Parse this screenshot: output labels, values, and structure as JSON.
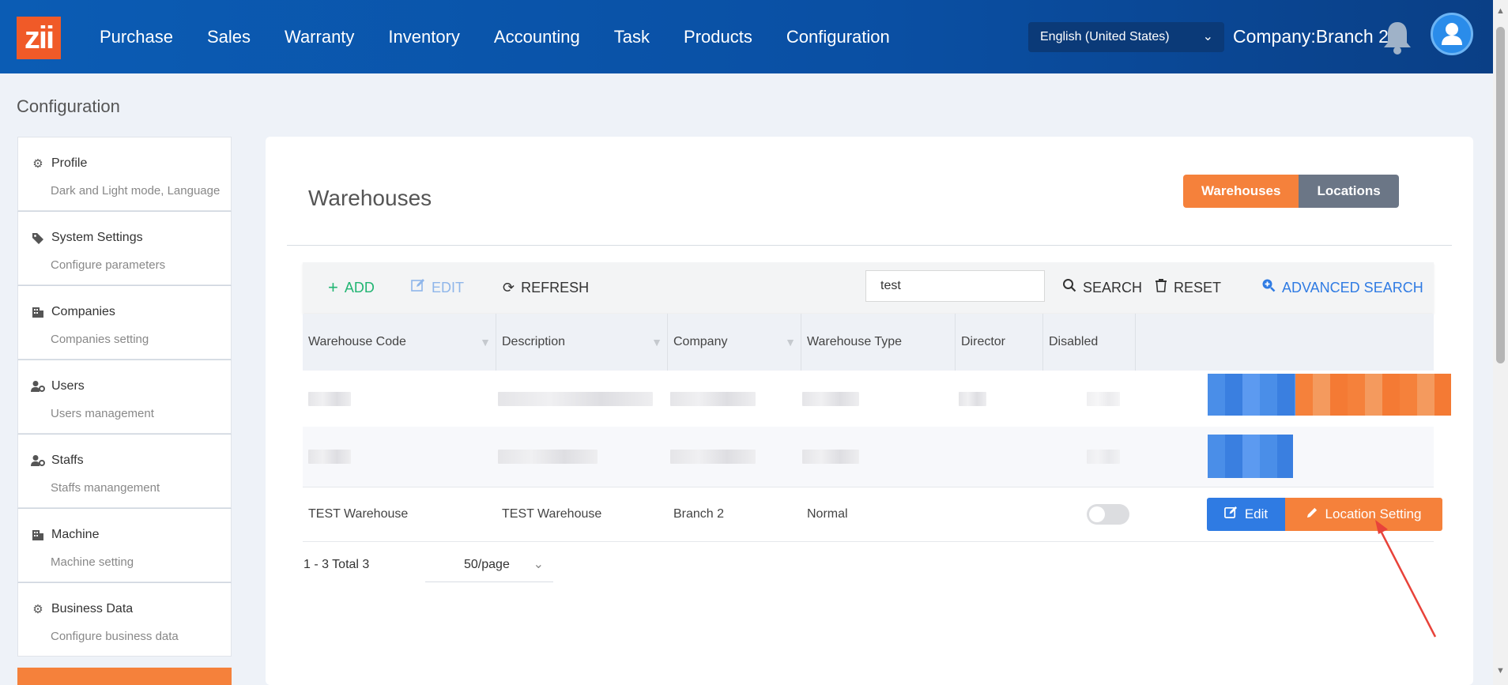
{
  "app": {
    "logo_text": "zii",
    "nav": [
      "Purchase",
      "Sales",
      "Warranty",
      "Inventory",
      "Accounting",
      "Task",
      "Products",
      "Configuration"
    ],
    "language": "English (United States)",
    "company": "Company:Branch 2"
  },
  "page": {
    "heading": "Configuration"
  },
  "sidebar": {
    "items": [
      {
        "title": "Profile",
        "subtitle": "Dark and Light mode, Language",
        "icon": "gear-icon"
      },
      {
        "title": "System Settings",
        "subtitle": "Configure parameters",
        "icon": "tags-icon"
      },
      {
        "title": "Companies",
        "subtitle": "Companies setting",
        "icon": "building-icon"
      },
      {
        "title": "Users",
        "subtitle": "Users management",
        "icon": "user-gear-icon"
      },
      {
        "title": "Staffs",
        "subtitle": "Staffs manangement",
        "icon": "user-gear-icon"
      },
      {
        "title": "Machine",
        "subtitle": "Machine setting",
        "icon": "building-icon"
      },
      {
        "title": "Business Data",
        "subtitle": "Configure business data",
        "icon": "gear-icon"
      }
    ]
  },
  "panel": {
    "title": "Warehouses",
    "tabs": {
      "active": "Warehouses",
      "inactive": "Locations"
    }
  },
  "toolbar": {
    "add": "ADD",
    "edit": "EDIT",
    "refresh": "REFRESH",
    "search_value": "test",
    "search": "SEARCH",
    "reset": "RESET",
    "advanced_search": "ADVANCED SEARCH"
  },
  "table": {
    "columns": [
      "Warehouse Code",
      "Description",
      "Company",
      "Warehouse Type",
      "Director",
      "Disabled"
    ],
    "rows": [
      {
        "code": "TEST Warehouse",
        "description": "TEST Warehouse",
        "company": "Branch 2",
        "type": "Normal",
        "director": "",
        "disabled": false
      }
    ],
    "row_actions": {
      "edit": "Edit",
      "location": "Location Setting"
    }
  },
  "pager": {
    "summary": "1 - 3 Total 3",
    "page_size": "50/page"
  },
  "colors": {
    "primary": "#0b5cb4",
    "accent": "#f5813b",
    "blue_button": "#2f7be3"
  }
}
